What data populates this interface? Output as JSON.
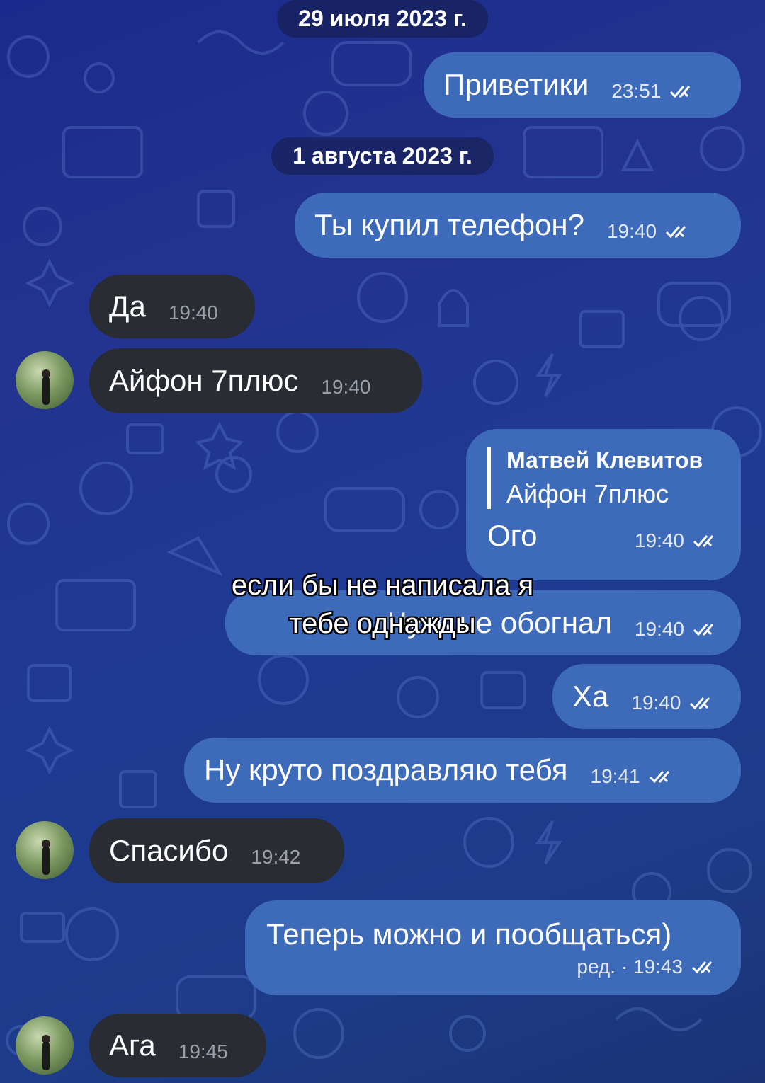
{
  "dates": [
    "29 июля 2023 г.",
    "1 августа 2023 г."
  ],
  "messages": [
    {
      "text": "Приветики",
      "time": "23:51"
    },
    {
      "text": "Ты купил телефон?",
      "time": "19:40"
    },
    {
      "text": "Да",
      "time": "19:40"
    },
    {
      "text": "Айфон 7плюс",
      "time": "19:40"
    },
    {
      "reply_to_name": "Матвей Клевитов",
      "reply_to_text": "Айфон 7плюс",
      "text": "Ого",
      "time": "19:40"
    },
    {
      "text": "Чуть не обогнал",
      "time": "19:40"
    },
    {
      "text": "Ха",
      "time": "19:40"
    },
    {
      "text": "Ну круто поздравляю тебя",
      "time": "19:41"
    },
    {
      "text": "Спасибо",
      "time": "19:42"
    },
    {
      "text": "Теперь можно и пообщаться)",
      "edited_time": "ред. · 19:43"
    },
    {
      "text": "Ага",
      "time": "19:45"
    }
  ],
  "overlay_caption": [
    "если бы не написала я",
    "тебе однажды"
  ],
  "icons": {
    "read": "double-check-icon"
  },
  "colors": {
    "outgoing": "#3d6bb9",
    "incoming": "#2a2c33",
    "background": "#1f3a93"
  }
}
